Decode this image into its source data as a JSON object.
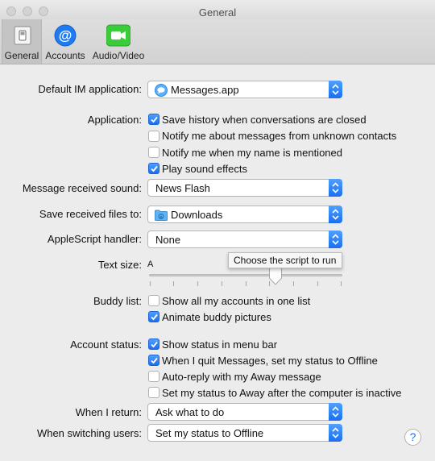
{
  "window": {
    "title": "General"
  },
  "tabs": [
    {
      "label": "General",
      "icon": "switch-icon",
      "selected": true
    },
    {
      "label": "Accounts",
      "icon": "at-sign-icon",
      "selected": false
    },
    {
      "label": "Audio/Video",
      "icon": "video-camera-icon",
      "selected": false
    }
  ],
  "default_im": {
    "label": "Default IM application:",
    "value": "Messages.app",
    "icon": "messages-app-icon"
  },
  "application": {
    "label": "Application:",
    "options": [
      {
        "label": "Save history when conversations are closed",
        "checked": true
      },
      {
        "label": "Notify me about messages from unknown contacts",
        "checked": false
      },
      {
        "label": "Notify me when my name is mentioned",
        "checked": false
      },
      {
        "label": "Play sound effects",
        "checked": true
      }
    ]
  },
  "message_sound": {
    "label": "Message received sound:",
    "value": "News Flash"
  },
  "save_files": {
    "label": "Save received files to:",
    "value": "Downloads",
    "icon": "folder-icon"
  },
  "applescript": {
    "label": "AppleScript handler:",
    "value": "None",
    "tooltip": "Choose the script to run"
  },
  "text_size": {
    "label": "Text size:",
    "small_glyph": "A",
    "level": 0.63,
    "ticks": 9
  },
  "buddy_list": {
    "label": "Buddy list:",
    "options": [
      {
        "label": "Show all my accounts in one list",
        "checked": false
      },
      {
        "label": "Animate buddy pictures",
        "checked": true
      }
    ]
  },
  "account_status": {
    "label": "Account status:",
    "options": [
      {
        "label": "Show status in menu bar",
        "checked": true
      },
      {
        "label": "When I quit Messages, set my status to Offline",
        "checked": true
      },
      {
        "label": "Auto-reply with my Away message",
        "checked": false
      },
      {
        "label": "Set my status to Away after the computer is inactive",
        "checked": false
      }
    ]
  },
  "when_return": {
    "label": "When I return:",
    "value": "Ask what to do"
  },
  "switching_users": {
    "label": "When switching users:",
    "value": "Set my status to Offline"
  },
  "help": {
    "glyph": "?"
  },
  "colors": {
    "accent": "#1a6ff0",
    "background": "#ececec"
  }
}
